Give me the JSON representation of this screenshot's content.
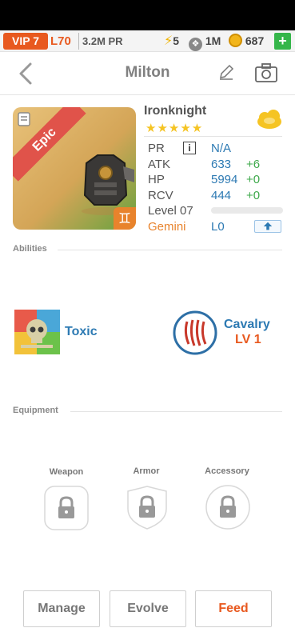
{
  "topbar": {
    "vip": "VIP 7",
    "level": "L70",
    "power": "3.2M PR",
    "energy": "5",
    "paw": "1M",
    "gold": "687",
    "add": "+"
  },
  "header": {
    "title": "Milton"
  },
  "hero": {
    "rarity": "Epic",
    "name": "Ironknight",
    "stars": "★★★★★",
    "stats": {
      "pr_label": "PR",
      "pr_value": "N/A",
      "atk_label": "ATK",
      "atk_value": "633",
      "atk_bonus": "+6",
      "hp_label": "HP",
      "hp_value": "5994",
      "hp_bonus": "+0",
      "rcv_label": "RCV",
      "rcv_value": "444",
      "rcv_bonus": "+0",
      "level_label": "Level 07",
      "level_progress": 0.0,
      "sign_label": "Gemini",
      "sign_value": "L0"
    }
  },
  "abilities": {
    "section_label": "Abilities",
    "skill_name": "Toxic",
    "passive_name": "Cavalry",
    "passive_level": "LV 1"
  },
  "equipment": {
    "section_label": "Equipment",
    "slots": [
      "Weapon",
      "Armor",
      "Accessory"
    ]
  },
  "actions": {
    "manage": "Manage",
    "evolve": "Evolve",
    "feed": "Feed"
  },
  "colors": {
    "accent": "#e8591f",
    "blue": "#2d7ab3",
    "green": "#3ea94b",
    "gold": "#f5c423"
  }
}
